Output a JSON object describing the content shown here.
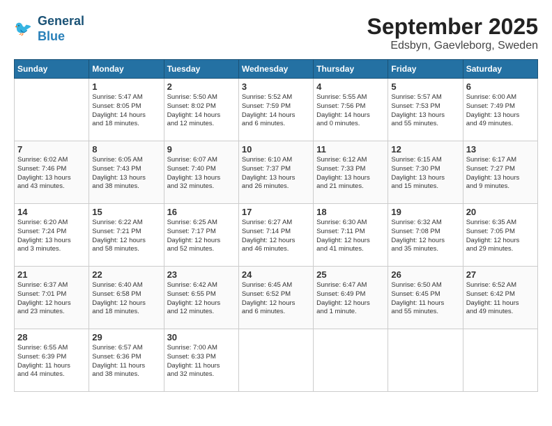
{
  "header": {
    "logo_line1": "General",
    "logo_line2": "Blue",
    "month": "September 2025",
    "location": "Edsbyn, Gaevleborg, Sweden"
  },
  "days_of_week": [
    "Sunday",
    "Monday",
    "Tuesday",
    "Wednesday",
    "Thursday",
    "Friday",
    "Saturday"
  ],
  "weeks": [
    [
      {
        "day": "",
        "content": ""
      },
      {
        "day": "1",
        "content": "Sunrise: 5:47 AM\nSunset: 8:05 PM\nDaylight: 14 hours\nand 18 minutes."
      },
      {
        "day": "2",
        "content": "Sunrise: 5:50 AM\nSunset: 8:02 PM\nDaylight: 14 hours\nand 12 minutes."
      },
      {
        "day": "3",
        "content": "Sunrise: 5:52 AM\nSunset: 7:59 PM\nDaylight: 14 hours\nand 6 minutes."
      },
      {
        "day": "4",
        "content": "Sunrise: 5:55 AM\nSunset: 7:56 PM\nDaylight: 14 hours\nand 0 minutes."
      },
      {
        "day": "5",
        "content": "Sunrise: 5:57 AM\nSunset: 7:53 PM\nDaylight: 13 hours\nand 55 minutes."
      },
      {
        "day": "6",
        "content": "Sunrise: 6:00 AM\nSunset: 7:49 PM\nDaylight: 13 hours\nand 49 minutes."
      }
    ],
    [
      {
        "day": "7",
        "content": "Sunrise: 6:02 AM\nSunset: 7:46 PM\nDaylight: 13 hours\nand 43 minutes."
      },
      {
        "day": "8",
        "content": "Sunrise: 6:05 AM\nSunset: 7:43 PM\nDaylight: 13 hours\nand 38 minutes."
      },
      {
        "day": "9",
        "content": "Sunrise: 6:07 AM\nSunset: 7:40 PM\nDaylight: 13 hours\nand 32 minutes."
      },
      {
        "day": "10",
        "content": "Sunrise: 6:10 AM\nSunset: 7:37 PM\nDaylight: 13 hours\nand 26 minutes."
      },
      {
        "day": "11",
        "content": "Sunrise: 6:12 AM\nSunset: 7:33 PM\nDaylight: 13 hours\nand 21 minutes."
      },
      {
        "day": "12",
        "content": "Sunrise: 6:15 AM\nSunset: 7:30 PM\nDaylight: 13 hours\nand 15 minutes."
      },
      {
        "day": "13",
        "content": "Sunrise: 6:17 AM\nSunset: 7:27 PM\nDaylight: 13 hours\nand 9 minutes."
      }
    ],
    [
      {
        "day": "14",
        "content": "Sunrise: 6:20 AM\nSunset: 7:24 PM\nDaylight: 13 hours\nand 3 minutes."
      },
      {
        "day": "15",
        "content": "Sunrise: 6:22 AM\nSunset: 7:21 PM\nDaylight: 12 hours\nand 58 minutes."
      },
      {
        "day": "16",
        "content": "Sunrise: 6:25 AM\nSunset: 7:17 PM\nDaylight: 12 hours\nand 52 minutes."
      },
      {
        "day": "17",
        "content": "Sunrise: 6:27 AM\nSunset: 7:14 PM\nDaylight: 12 hours\nand 46 minutes."
      },
      {
        "day": "18",
        "content": "Sunrise: 6:30 AM\nSunset: 7:11 PM\nDaylight: 12 hours\nand 41 minutes."
      },
      {
        "day": "19",
        "content": "Sunrise: 6:32 AM\nSunset: 7:08 PM\nDaylight: 12 hours\nand 35 minutes."
      },
      {
        "day": "20",
        "content": "Sunrise: 6:35 AM\nSunset: 7:05 PM\nDaylight: 12 hours\nand 29 minutes."
      }
    ],
    [
      {
        "day": "21",
        "content": "Sunrise: 6:37 AM\nSunset: 7:01 PM\nDaylight: 12 hours\nand 23 minutes."
      },
      {
        "day": "22",
        "content": "Sunrise: 6:40 AM\nSunset: 6:58 PM\nDaylight: 12 hours\nand 18 minutes."
      },
      {
        "day": "23",
        "content": "Sunrise: 6:42 AM\nSunset: 6:55 PM\nDaylight: 12 hours\nand 12 minutes."
      },
      {
        "day": "24",
        "content": "Sunrise: 6:45 AM\nSunset: 6:52 PM\nDaylight: 12 hours\nand 6 minutes."
      },
      {
        "day": "25",
        "content": "Sunrise: 6:47 AM\nSunset: 6:49 PM\nDaylight: 12 hours\nand 1 minute."
      },
      {
        "day": "26",
        "content": "Sunrise: 6:50 AM\nSunset: 6:45 PM\nDaylight: 11 hours\nand 55 minutes."
      },
      {
        "day": "27",
        "content": "Sunrise: 6:52 AM\nSunset: 6:42 PM\nDaylight: 11 hours\nand 49 minutes."
      }
    ],
    [
      {
        "day": "28",
        "content": "Sunrise: 6:55 AM\nSunset: 6:39 PM\nDaylight: 11 hours\nand 44 minutes."
      },
      {
        "day": "29",
        "content": "Sunrise: 6:57 AM\nSunset: 6:36 PM\nDaylight: 11 hours\nand 38 minutes."
      },
      {
        "day": "30",
        "content": "Sunrise: 7:00 AM\nSunset: 6:33 PM\nDaylight: 11 hours\nand 32 minutes."
      },
      {
        "day": "",
        "content": ""
      },
      {
        "day": "",
        "content": ""
      },
      {
        "day": "",
        "content": ""
      },
      {
        "day": "",
        "content": ""
      }
    ]
  ]
}
